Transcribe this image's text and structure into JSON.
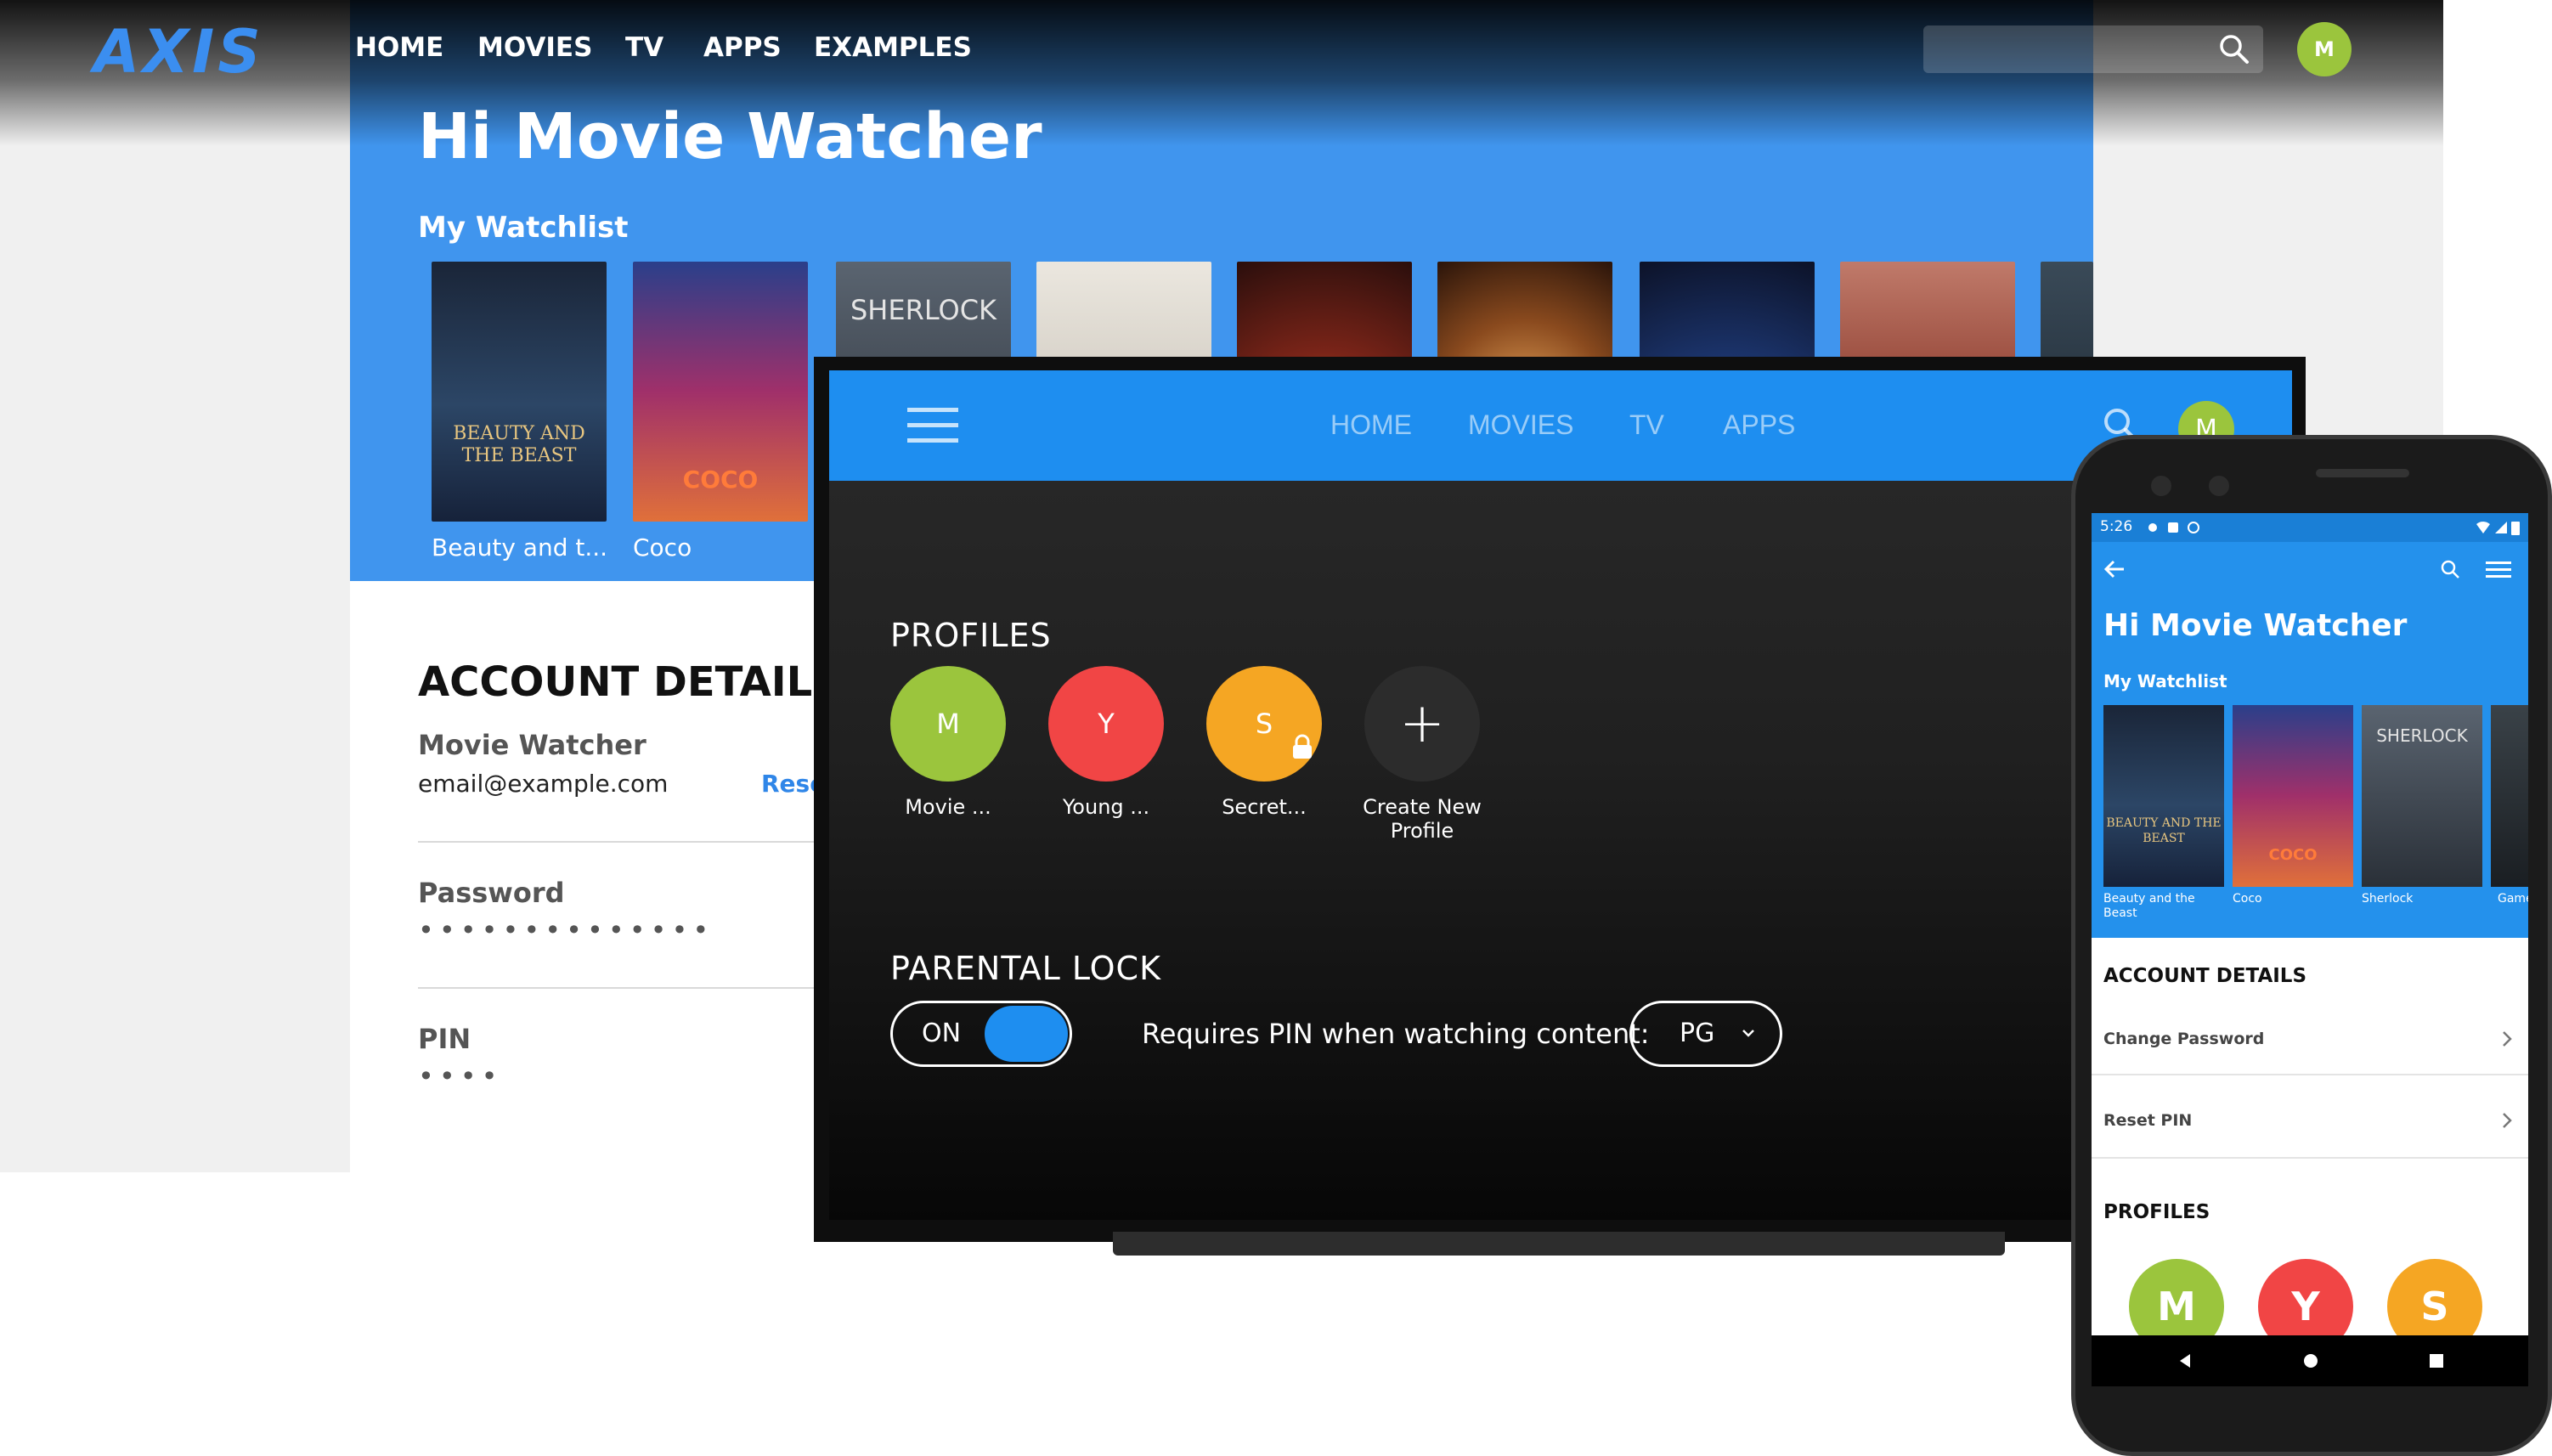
{
  "desktop": {
    "logo": "AXIS",
    "nav": [
      "HOME",
      "MOVIES",
      "TV",
      "APPS",
      "EXAMPLES"
    ],
    "avatar_initial": "M",
    "greeting": "Hi Movie Watcher",
    "watchlist_title": "My Watchlist",
    "watchlist": [
      {
        "caption": "Beauty and t...",
        "poster_text": "BEAUTY AND THE BEAST",
        "color": "#22344d"
      },
      {
        "caption": "Coco",
        "poster_text": "COCO",
        "color": "#8a2b4d"
      },
      {
        "caption": "",
        "poster_text": "SHERLOCK",
        "color": "#3d4650"
      },
      {
        "caption": "",
        "poster_text": "",
        "color": "#d6d2cb"
      },
      {
        "caption": "",
        "poster_text": "",
        "color": "#5a1e16"
      },
      {
        "caption": "",
        "poster_text": "",
        "color": "#7a4a22"
      },
      {
        "caption": "",
        "poster_text": "",
        "color": "#1e3a78"
      },
      {
        "caption": "",
        "poster_text": "",
        "color": "#9a4c3c"
      },
      {
        "caption": "",
        "poster_text": "",
        "color": "#23303d"
      }
    ],
    "account": {
      "title": "ACCOUNT DETAILS",
      "name": "Movie Watcher",
      "email": "email@example.com",
      "reset_link": "Rese",
      "password_label": "Password",
      "password_dots": "••••••••••••••",
      "pin_label": "PIN",
      "pin_dots": "••••"
    }
  },
  "tv": {
    "nav": [
      "HOME",
      "MOVIES",
      "TV",
      "APPS"
    ],
    "avatar_initial": "M",
    "profiles_title": "PROFILES",
    "profiles": [
      {
        "initial": "M",
        "label": "Movie ...",
        "color": "#9bc53d",
        "locked": false
      },
      {
        "initial": "Y",
        "label": "Young ...",
        "color": "#f14545",
        "locked": false
      },
      {
        "initial": "S",
        "label": "Secret...",
        "color": "#f5a623",
        "locked": true
      }
    ],
    "create_profile_label": "Create New Profile",
    "create_profile_icon": "+",
    "parental_lock_title": "PARENTAL LOCK",
    "toggle_label": "ON",
    "toggle_on": true,
    "pin_requirement_text": "Requires PIN when watching content:",
    "rating_value": "PG",
    "accent_color": "#1e8ef0"
  },
  "phone": {
    "status_time": "5:26",
    "greeting": "Hi Movie Watcher",
    "watchlist_title": "My Watchlist",
    "watchlist": [
      {
        "caption": "Beauty and the Beast",
        "color": "#22344d",
        "poster_text": "BEAUTY AND THE BEAST"
      },
      {
        "caption": "Coco",
        "color": "#8a2b4d",
        "poster_text": "COCO"
      },
      {
        "caption": "Sherlock",
        "color": "#3d4650",
        "poster_text": "SHERLOCK"
      },
      {
        "caption": "Game",
        "color": "#2a2f33",
        "poster_text": ""
      }
    ],
    "account_title": "ACCOUNT DETAILS",
    "rows": [
      "Change Password",
      "Reset PIN"
    ],
    "profiles_title": "PROFILES",
    "profiles": [
      {
        "initial": "M",
        "color": "#9bc53d"
      },
      {
        "initial": "Y",
        "color": "#f14545"
      },
      {
        "initial": "S",
        "color": "#f5a623"
      }
    ]
  }
}
